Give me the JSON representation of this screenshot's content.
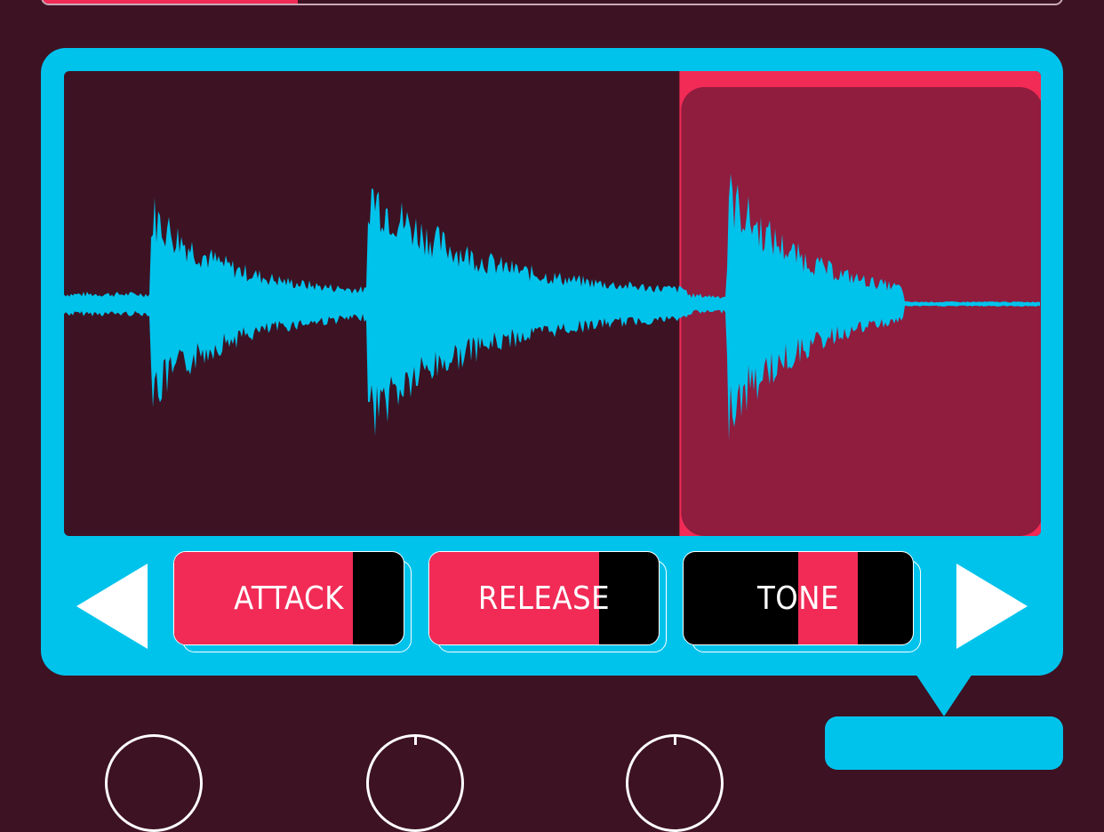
{
  "progress": {
    "value": 0.25,
    "color": "#f12b56"
  },
  "waveform": {
    "color": "#00c3ec",
    "background": "#3d1222",
    "selection": {
      "start": 0.63,
      "end": 1.0,
      "color": "#f12b56",
      "inner_color": "#901c3e"
    }
  },
  "params": [
    {
      "label": "ATTACK",
      "fill_start": 0.0,
      "fill_end": 0.78
    },
    {
      "label": "RELEASE",
      "fill_start": 0.0,
      "fill_end": 0.74
    },
    {
      "label": "TONE",
      "fill_start": 0.5,
      "fill_end": 0.76
    }
  ],
  "nav": {
    "prev_icon": "arrow-left-icon",
    "next_icon": "arrow-right-icon"
  },
  "colors": {
    "accent": "#00c3ec",
    "highlight": "#f12b56",
    "bg": "#3d1222"
  }
}
